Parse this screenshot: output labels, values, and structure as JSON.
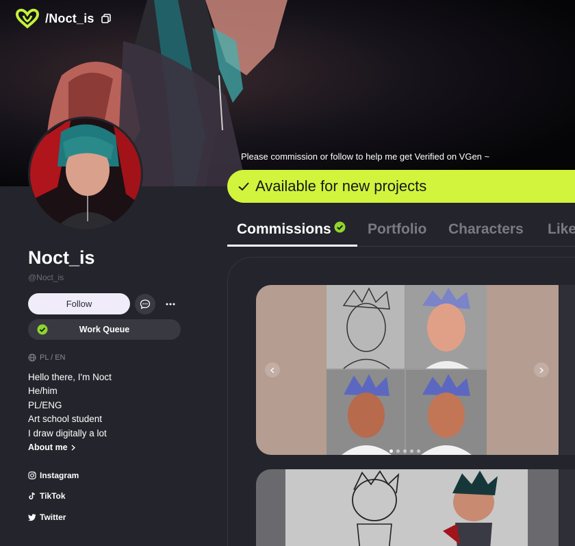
{
  "topbar": {
    "path_title": "/Noct_is"
  },
  "profile": {
    "name": "Noct_is",
    "handle": "@Noct_is",
    "follow_label": "Follow",
    "work_queue_label": "Work Queue",
    "languages": "PL / EN",
    "bio": [
      "Hello there, I'm Noct",
      "He/him",
      "PL/ENG",
      "Art school student",
      "I draw digitally a lot"
    ],
    "about_label": "About me",
    "socials": [
      {
        "label": "Instagram",
        "icon": "instagram-icon"
      },
      {
        "label": "TikTok",
        "icon": "tiktok-icon"
      },
      {
        "label": "Twitter",
        "icon": "twitter-icon"
      }
    ]
  },
  "status": {
    "notice": "Please commission or follow to help me get Verified on VGen ~",
    "available_label": "Available for new projects"
  },
  "tabs": [
    {
      "label": "Commissions",
      "active": true
    },
    {
      "label": "Portfolio",
      "active": false
    },
    {
      "label": "Characters",
      "active": false
    },
    {
      "label": "Like",
      "active": false
    }
  ],
  "carousel": {
    "slide_count": 5,
    "active_index": 0
  },
  "colors": {
    "accent": "#d2f43c",
    "background": "#24242c",
    "verified": "#8fd62c",
    "follow_button": "#f0ecfa"
  }
}
